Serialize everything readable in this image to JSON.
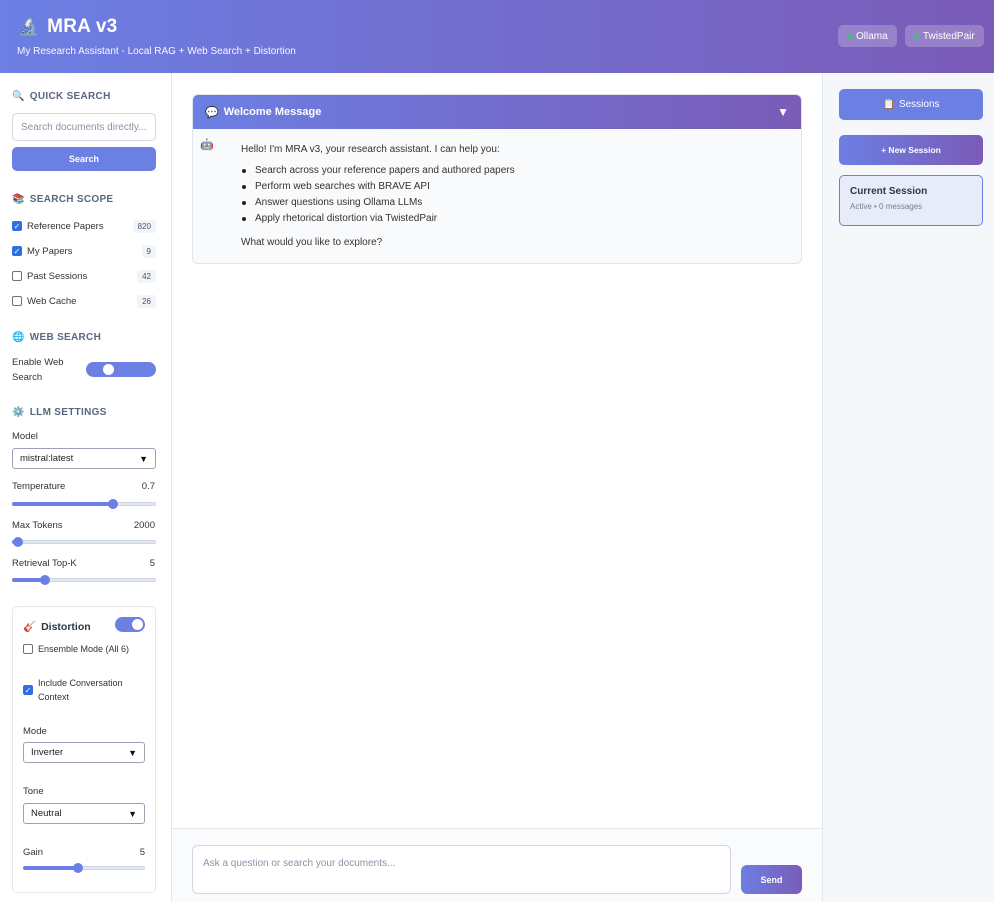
{
  "header": {
    "icon": "🔬",
    "title": "MRA v3",
    "subtitle": "My Research Assistant - Local RAG + Web Search + Distortion",
    "status": [
      {
        "label": "Ollama",
        "color": "#48bb78"
      },
      {
        "label": "TwistedPair",
        "color": "#48bb78"
      }
    ]
  },
  "quick_search": {
    "title": "QUICK SEARCH",
    "placeholder": "Search documents directly...",
    "button": "Search"
  },
  "scope": {
    "title": "SEARCH SCOPE",
    "items": [
      {
        "label": "Reference Papers",
        "count": "820",
        "checked": true
      },
      {
        "label": "My Papers",
        "count": "9",
        "checked": true
      },
      {
        "label": "Past Sessions",
        "count": "42",
        "checked": false
      },
      {
        "label": "Web Cache",
        "count": "26",
        "checked": false
      }
    ]
  },
  "web_search": {
    "title": "WEB SEARCH",
    "label_line1": "Enable Web",
    "label_line2": "Search",
    "enabled": true
  },
  "llm": {
    "title": "LLM SETTINGS",
    "model_label": "Model",
    "model_value": "mistral:latest",
    "temperature_label": "Temperature",
    "temperature_value": "0.7",
    "temperature_fraction": 0.7,
    "max_tokens_label": "Max Tokens",
    "max_tokens_value": "2000",
    "max_tokens_fraction": 0.04,
    "topk_label": "Retrieval Top-K",
    "topk_value": "5",
    "topk_fraction": 0.23
  },
  "distortion": {
    "icon": "🎸",
    "title": "Distortion",
    "enabled": true,
    "ensemble_label": "Ensemble Mode (All 6)",
    "ensemble_checked": false,
    "context_line1": "Include Conversation",
    "context_line2": "Context",
    "context_checked": true,
    "mode_label": "Mode",
    "mode_value": "Inverter",
    "tone_label": "Tone",
    "tone_value": "Neutral",
    "gain_label": "Gain",
    "gain_value": "5",
    "gain_fraction": 0.45
  },
  "welcome": {
    "title": "Welcome Message",
    "intro": "Hello! I'm MRA v3, your research assistant. I can help you:",
    "bullets": [
      "Search across your reference papers and authored papers",
      "Perform web searches with BRAVE API",
      "Answer questions using Ollama LLMs",
      "Apply rhetorical distortion via TwistedPair"
    ],
    "outro": "What would you like to explore?"
  },
  "chat": {
    "placeholder": "Ask a question or search your documents...",
    "send": "Send"
  },
  "sessions": {
    "button": "Sessions",
    "new_button": "+ New Session",
    "current_title": "Current Session",
    "current_status": "Active • 0 messages"
  },
  "colors": {
    "accent": "#6c7fe3",
    "accent_end": "#7a5bb8",
    "status_ok": "#48bb78"
  }
}
